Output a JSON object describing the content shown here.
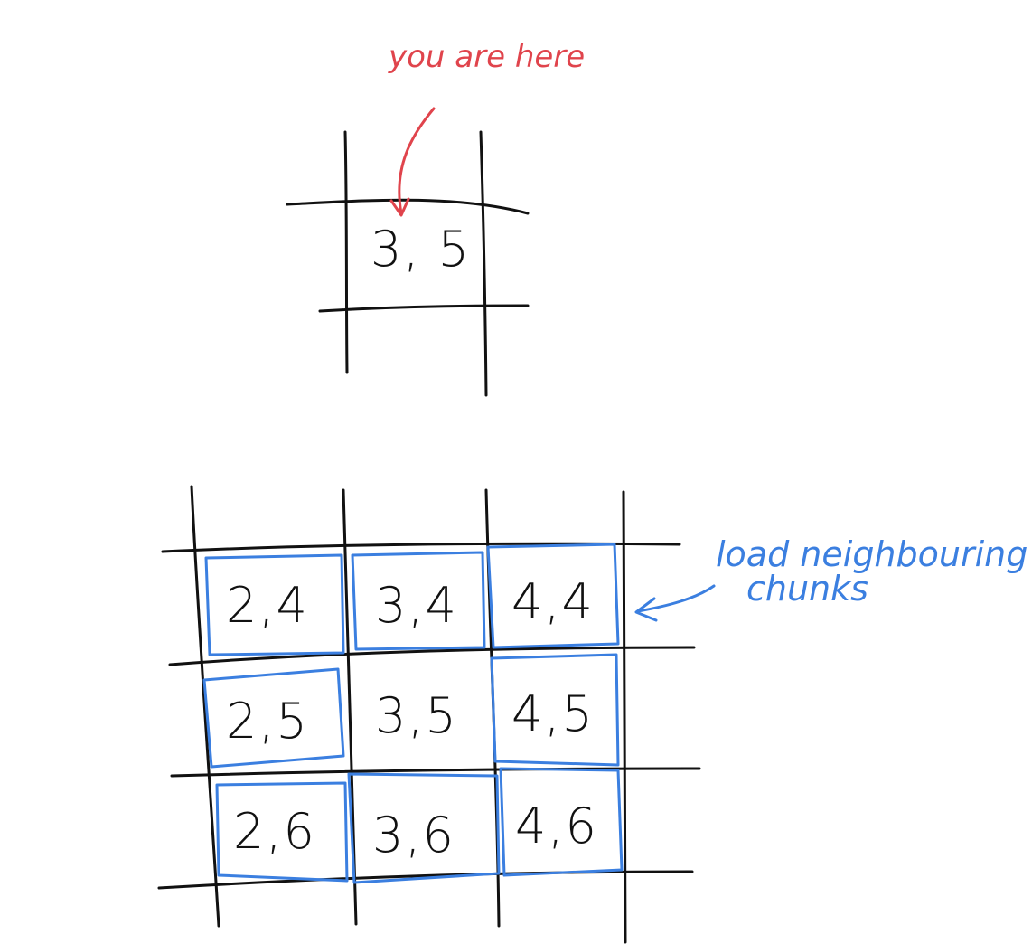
{
  "top_annotation": {
    "text": "you are here",
    "color": "#e0444c"
  },
  "current_chunk": {
    "label": "3, 5"
  },
  "neighbor_annotation": {
    "line1": "load neighbouring",
    "line2": "chunks",
    "color": "#3b7fe0"
  },
  "grid": {
    "rows": [
      [
        "2,4",
        "3,4",
        "4,4"
      ],
      [
        "2,5",
        "3,5",
        "4,5"
      ],
      [
        "2,6",
        "3,6",
        "4,6"
      ]
    ],
    "highlighted": [
      [
        true,
        true,
        true
      ],
      [
        true,
        false,
        true
      ],
      [
        true,
        true,
        true
      ]
    ]
  }
}
